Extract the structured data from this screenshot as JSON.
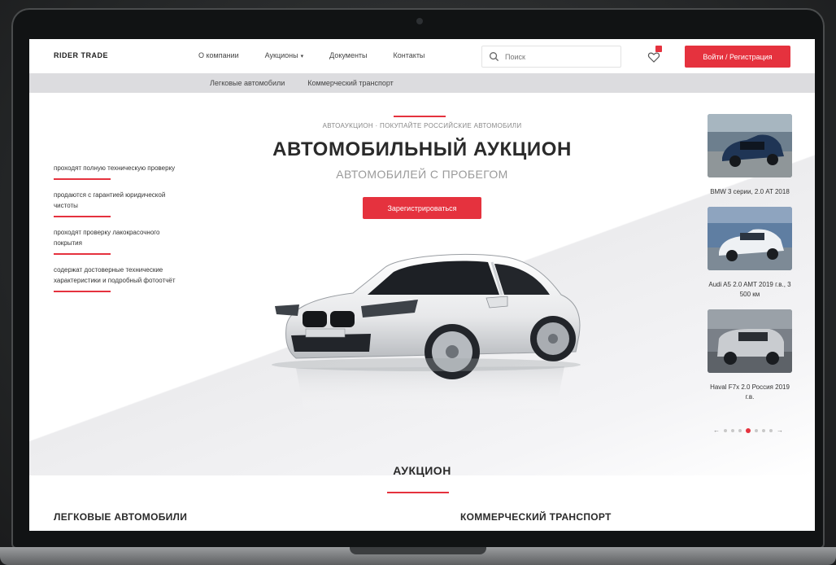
{
  "header": {
    "logo_text": "RIDER TRADE",
    "logo_mark": "",
    "nav": [
      {
        "label": "О компании"
      },
      {
        "label": "Аукционы"
      },
      {
        "label": "Документы"
      },
      {
        "label": "Контакты"
      }
    ],
    "search_placeholder": "Поиск",
    "login_label": "Войти / Регистрация"
  },
  "subnav": [
    "Легковые автомобили",
    "Коммерческий транспорт"
  ],
  "hero": {
    "kicker": "АВТОАУКЦИОН · ПОКУПАЙТЕ РОССИЙСКИЕ АВТОМОБИЛИ",
    "title": "АВТОМОБИЛЬНЫЙ АУКЦИОН",
    "subtitle": "АВТОМОБИЛЕЙ С ПРОБЕГОМ",
    "register_label": "Зарегистрироваться"
  },
  "features": [
    "проходят полную техническую проверку",
    "продаются с гарантией юридической чистоты",
    "проходят проверку лакокрасочного покрытия",
    "содержат достоверные технические характеристики и подробный фотоотчёт"
  ],
  "lots": [
    {
      "caption": "BMW 3 серии, 2.0 AT 2018"
    },
    {
      "caption": "Audi A5 2.0 AMT 2019 г.в., 3 500 км"
    },
    {
      "caption": "Haval F7x 2.0 Россия 2019 г.в."
    }
  ],
  "auction": {
    "title": "АУКЦИОН",
    "left_category": "ЛЕГКОВЫЕ АВТОМОБИЛИ",
    "right_category": "КОММЕРЧЕСКИЙ ТРАНСПОРТ"
  },
  "colors": {
    "accent": "#e5323e",
    "subnav_bg": "#dcdcdf"
  }
}
